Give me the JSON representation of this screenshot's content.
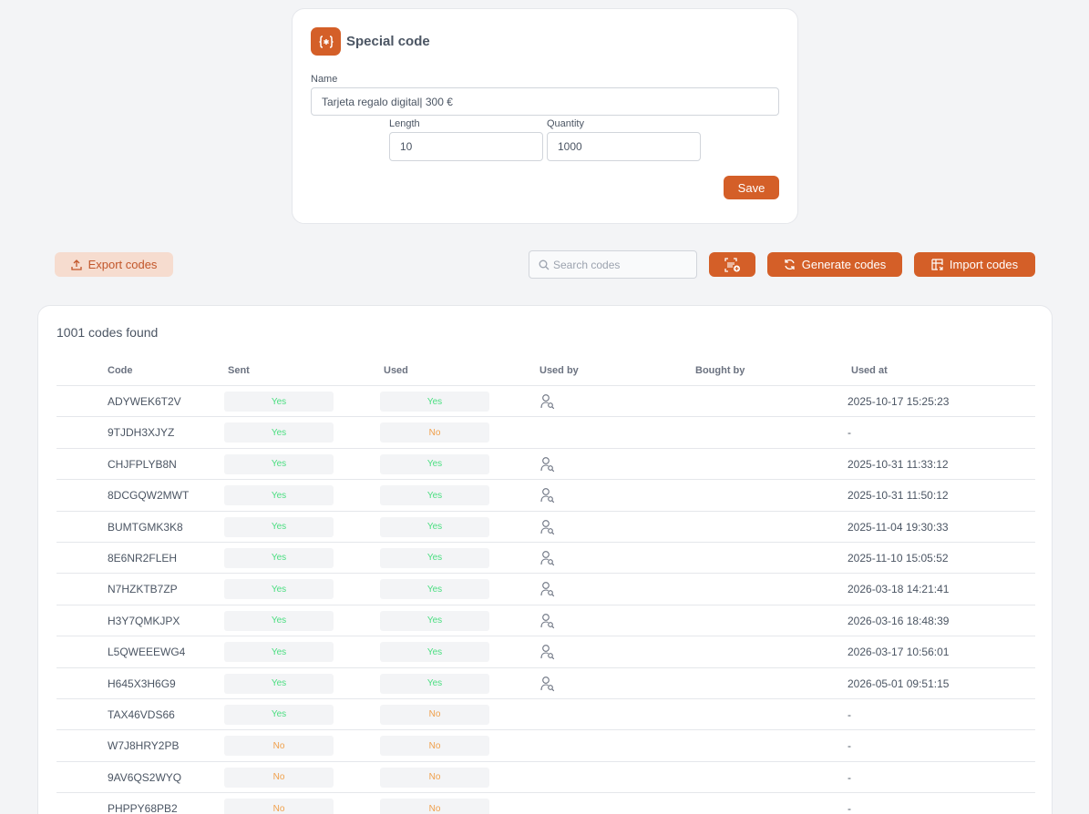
{
  "form": {
    "title": "Special code",
    "name_label": "Name",
    "name_value": "Tarjeta regalo digital| 300 €",
    "length_label": "Length",
    "length_value": "10",
    "quantity_label": "Quantity",
    "quantity_value": "1000",
    "save_label": "Save",
    "icon": "braces-asterisk-icon"
  },
  "toolbar": {
    "export_label": "Export codes",
    "search_placeholder": "Search codes",
    "generate_label": "Generate codes",
    "import_label": "Import codes"
  },
  "table": {
    "found_text": "1001 codes found",
    "headers": [
      "Code",
      "Sent",
      "Used",
      "Used by",
      "Bought by",
      "Used at"
    ],
    "rows": [
      {
        "code": "ADYWEK6T2V",
        "sent": "Yes",
        "used": "Yes",
        "used_by": true,
        "used_at": "2025-10-17 15:25:23"
      },
      {
        "code": "9TJDH3XJYZ",
        "sent": "Yes",
        "used": "No",
        "used_by": false,
        "used_at": "-"
      },
      {
        "code": "CHJFPLYB8N",
        "sent": "Yes",
        "used": "Yes",
        "used_by": true,
        "used_at": "2025-10-31 11:33:12"
      },
      {
        "code": "8DCGQW2MWT",
        "sent": "Yes",
        "used": "Yes",
        "used_by": true,
        "used_at": "2025-10-31 11:50:12"
      },
      {
        "code": "BUMTGMK3K8",
        "sent": "Yes",
        "used": "Yes",
        "used_by": true,
        "used_at": "2025-11-04 19:30:33"
      },
      {
        "code": "8E6NR2FLEH",
        "sent": "Yes",
        "used": "Yes",
        "used_by": true,
        "used_at": "2025-11-10 15:05:52"
      },
      {
        "code": "N7HZKTB7ZP",
        "sent": "Yes",
        "used": "Yes",
        "used_by": true,
        "used_at": "2026-03-18 14:21:41"
      },
      {
        "code": "H3Y7QMKJPX",
        "sent": "Yes",
        "used": "Yes",
        "used_by": true,
        "used_at": "2026-03-16 18:48:39"
      },
      {
        "code": "L5QWEEEWG4",
        "sent": "Yes",
        "used": "Yes",
        "used_by": true,
        "used_at": "2026-03-17 10:56:01"
      },
      {
        "code": "H645X3H6G9",
        "sent": "Yes",
        "used": "Yes",
        "used_by": true,
        "used_at": "2026-05-01 09:51:15"
      },
      {
        "code": "TAX46VDS66",
        "sent": "Yes",
        "used": "No",
        "used_by": false,
        "used_at": "-"
      },
      {
        "code": "W7J8HRY2PB",
        "sent": "No",
        "used": "No",
        "used_by": false,
        "used_at": "-"
      },
      {
        "code": "9AV6QS2WYQ",
        "sent": "No",
        "used": "No",
        "used_by": false,
        "used_at": "-"
      },
      {
        "code": "PHPPY68PB2",
        "sent": "No",
        "used": "No",
        "used_by": false,
        "used_at": "-"
      }
    ]
  },
  "colors": {
    "accent": "#d45f28",
    "yes": "#4ade80",
    "no": "#f0a04b"
  }
}
